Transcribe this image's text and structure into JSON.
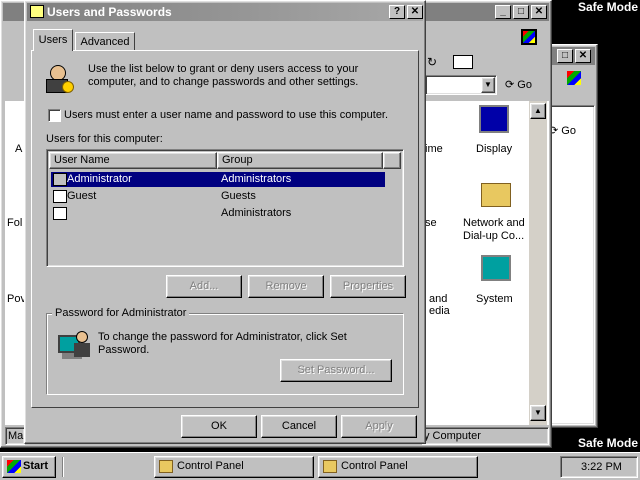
{
  "desktop": {
    "safe_mode_top": "Safe Mode",
    "safe_mode_bottom": "Safe Mode"
  },
  "bg_window_1": {
    "toolbar_go": "Go",
    "left_labels": [
      "A",
      "Fol",
      "Pov"
    ],
    "icon_labels": [
      "ime",
      "se",
      "and",
      "edia"
    ],
    "display_label": "Display",
    "network_label_1": "Network and",
    "network_label_2": "Dial-up Co...",
    "system_label": "System",
    "status_left": "Mar",
    "status_right": "y Computer"
  },
  "bg_window_2": {
    "toolbar_go": "Go"
  },
  "dialog": {
    "title": "Users and Passwords",
    "tabs": [
      "Users",
      "Advanced"
    ],
    "intro_text": "Use the list below to grant or deny users access to your computer, and to change passwords and other settings.",
    "checkbox_label": "Users must enter a user name and password to use this computer.",
    "checkbox_checked": false,
    "users_label": "Users for this computer:",
    "columns": [
      "User Name",
      "Group"
    ],
    "users": [
      {
        "name": "Administrator",
        "group": "Administrators",
        "selected": true
      },
      {
        "name": "Guest",
        "group": "Guests",
        "selected": false
      },
      {
        "name": "",
        "group": "Administrators",
        "selected": false
      }
    ],
    "add_button": "Add...",
    "remove_button": "Remove",
    "properties_button": "Properties",
    "password_group_title": "Password for Administrator",
    "password_text": "To change the password for Administrator, click Set Password.",
    "set_password_button": "Set Password...",
    "ok_button": "OK",
    "cancel_button": "Cancel",
    "apply_button": "Apply"
  },
  "taskbar": {
    "start_label": "Start",
    "tasks": [
      "Control Panel",
      "Control Panel"
    ],
    "clock": "3:22 PM"
  },
  "colors": {
    "selection": "#000080",
    "window_face": "#c0c0c0",
    "desktop": "#000000"
  }
}
